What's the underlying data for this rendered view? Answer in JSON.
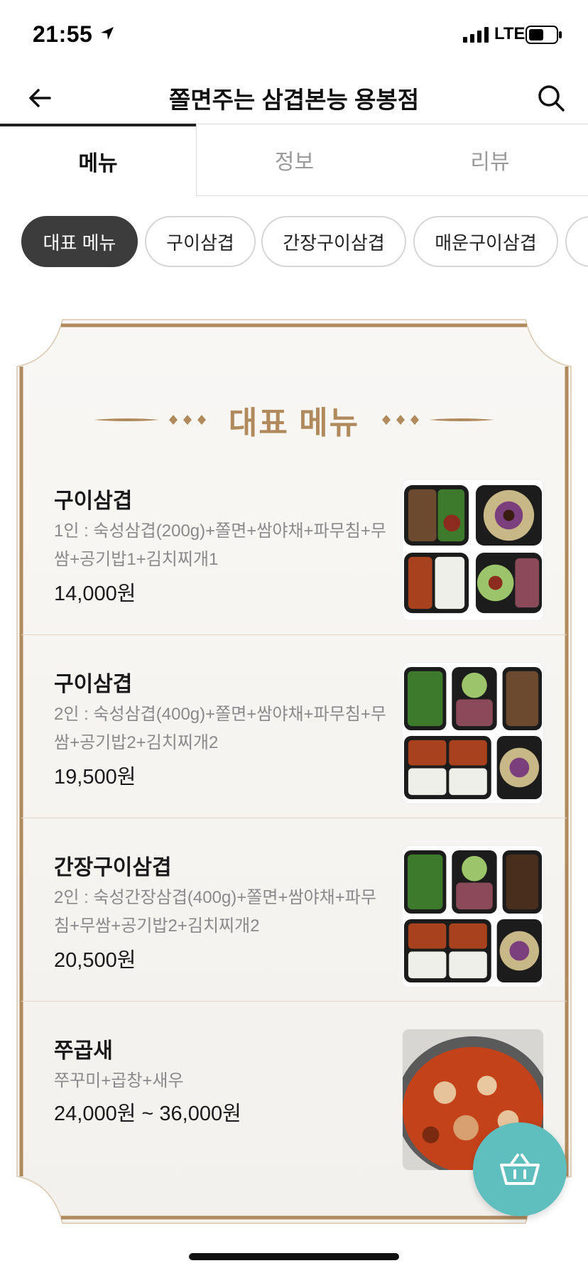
{
  "status": {
    "time": "21:55",
    "network": "LTE"
  },
  "header": {
    "title": "쫄면주는 삼겹본능 용봉점"
  },
  "tabs": [
    {
      "label": "메뉴",
      "active": true
    },
    {
      "label": "정보",
      "active": false
    },
    {
      "label": "리뷰",
      "active": false
    }
  ],
  "categories": [
    {
      "label": "대표 메뉴",
      "active": true
    },
    {
      "label": "구이삼겹",
      "active": false
    },
    {
      "label": "간장구이삼겹",
      "active": false
    },
    {
      "label": "매운구이삼겹",
      "active": false
    }
  ],
  "section": {
    "title": "대표 메뉴"
  },
  "menu": [
    {
      "name": "구이삼겹",
      "desc": "1인 : 숙성삼겹(200g)+쫄면+쌈야채+파무침+무쌈+공기밥1+김치찌개1",
      "price": "14,000원"
    },
    {
      "name": "구이삼겹",
      "desc": "2인 : 숙성삼겹(400g)+쫄면+쌈야채+파무침+무쌈+공기밥2+김치찌개2",
      "price": "19,500원"
    },
    {
      "name": "간장구이삼겹",
      "desc": "2인 : 숙성간장삼겹(400g)+쫄면+쌈야채+파무침+무쌈+공기밥2+김치찌개2",
      "price": "20,500원"
    },
    {
      "name": "쭈곱새",
      "desc": "쭈꾸미+곱창+새우",
      "price": "24,000원 ~ 36,000원"
    }
  ],
  "colors": {
    "accent_gold": "#b08a5c",
    "chip_active": "#3c3c3c",
    "fab": "#5fbfbf"
  },
  "icons": {
    "back": "arrow-left-icon",
    "search": "search-icon",
    "cart": "basket-icon"
  }
}
